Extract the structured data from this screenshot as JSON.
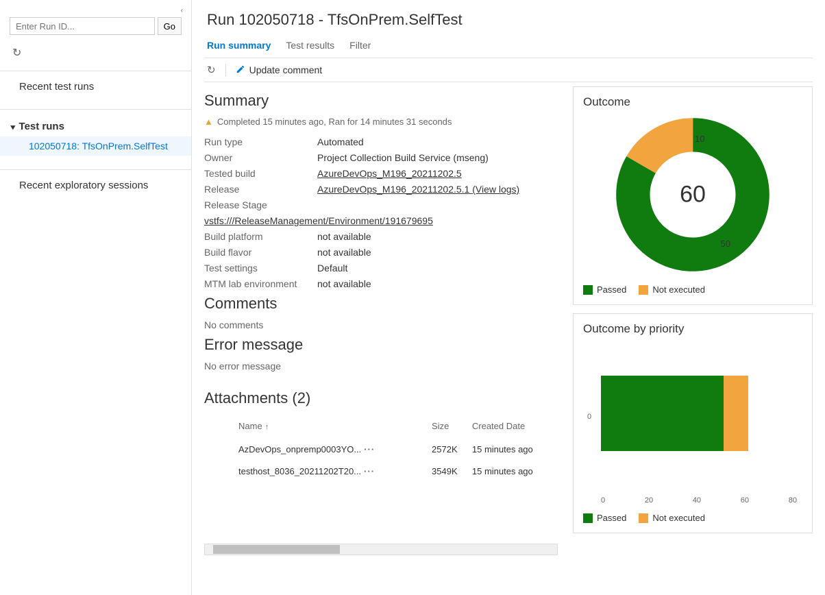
{
  "sidebar": {
    "search_placeholder": "Enter Run ID...",
    "go_label": "Go",
    "recent_runs_label": "Recent test runs",
    "tree_label": "Test runs",
    "tree_items": [
      {
        "label": "102050718: TfsOnPrem.SelfTest"
      }
    ],
    "recent_sessions_label": "Recent exploratory sessions"
  },
  "header": {
    "title": "Run 102050718 - TfsOnPrem.SelfTest"
  },
  "tabs": [
    {
      "label": "Run summary",
      "active": true
    },
    {
      "label": "Test results",
      "active": false
    },
    {
      "label": "Filter",
      "active": false
    }
  ],
  "toolbar": {
    "update_comment_label": "Update comment"
  },
  "summary": {
    "heading": "Summary",
    "status_text": "Completed 15 minutes ago, Ran for 14 minutes 31 seconds",
    "fields": {
      "run_type": {
        "k": "Run type",
        "v": "Automated"
      },
      "owner": {
        "k": "Owner",
        "v": "Project Collection Build Service (mseng)"
      },
      "tested_build": {
        "k": "Tested build",
        "v": "AzureDevOps_M196_20211202.5"
      },
      "release": {
        "k": "Release",
        "v": "AzureDevOps_M196_20211202.5.1 (View logs)"
      },
      "release_stage": {
        "k": "Release Stage",
        "v": "vstfs:///ReleaseManagement/Environment/191679695"
      },
      "build_platform": {
        "k": "Build platform",
        "v": "not available"
      },
      "build_flavor": {
        "k": "Build flavor",
        "v": "not available"
      },
      "test_settings": {
        "k": "Test settings",
        "v": "Default"
      },
      "mtm_env": {
        "k": "MTM lab environment",
        "v": "not available"
      }
    }
  },
  "comments": {
    "heading": "Comments",
    "body": "No comments"
  },
  "error": {
    "heading": "Error message",
    "body": "No error message"
  },
  "attachments": {
    "heading": "Attachments (2)",
    "columns": {
      "name": "Name",
      "size": "Size",
      "created": "Created Date"
    },
    "rows": [
      {
        "name": "AzDevOps_onpremp0003YO...",
        "size": "2572K",
        "created": "15 minutes ago"
      },
      {
        "name": "testhost_8036_20211202T20...",
        "size": "3549K",
        "created": "15 minutes ago"
      }
    ]
  },
  "outcome": {
    "heading": "Outcome",
    "total": 60,
    "passed_label": "Passed",
    "notexec_label": "Not executed",
    "colors": {
      "passed": "#107c10",
      "notexec": "#f2a53e"
    }
  },
  "outcome_priority": {
    "heading": "Outcome by priority",
    "y_label": "0",
    "passed_label": "Passed",
    "notexec_label": "Not executed"
  },
  "chart_data": [
    {
      "type": "pie",
      "title": "Outcome",
      "series": [
        {
          "name": "Passed",
          "value": 50,
          "color": "#107c10"
        },
        {
          "name": "Not executed",
          "value": 10,
          "color": "#f2a53e"
        }
      ],
      "total": 60
    },
    {
      "type": "bar",
      "orientation": "horizontal",
      "stacked": true,
      "title": "Outcome by priority",
      "categories": [
        "0"
      ],
      "series": [
        {
          "name": "Passed",
          "values": [
            50
          ],
          "color": "#107c10"
        },
        {
          "name": "Not executed",
          "values": [
            10
          ],
          "color": "#f2a53e"
        }
      ],
      "xlim": [
        0,
        80
      ],
      "xticks": [
        0,
        20,
        40,
        60,
        80
      ]
    }
  ]
}
